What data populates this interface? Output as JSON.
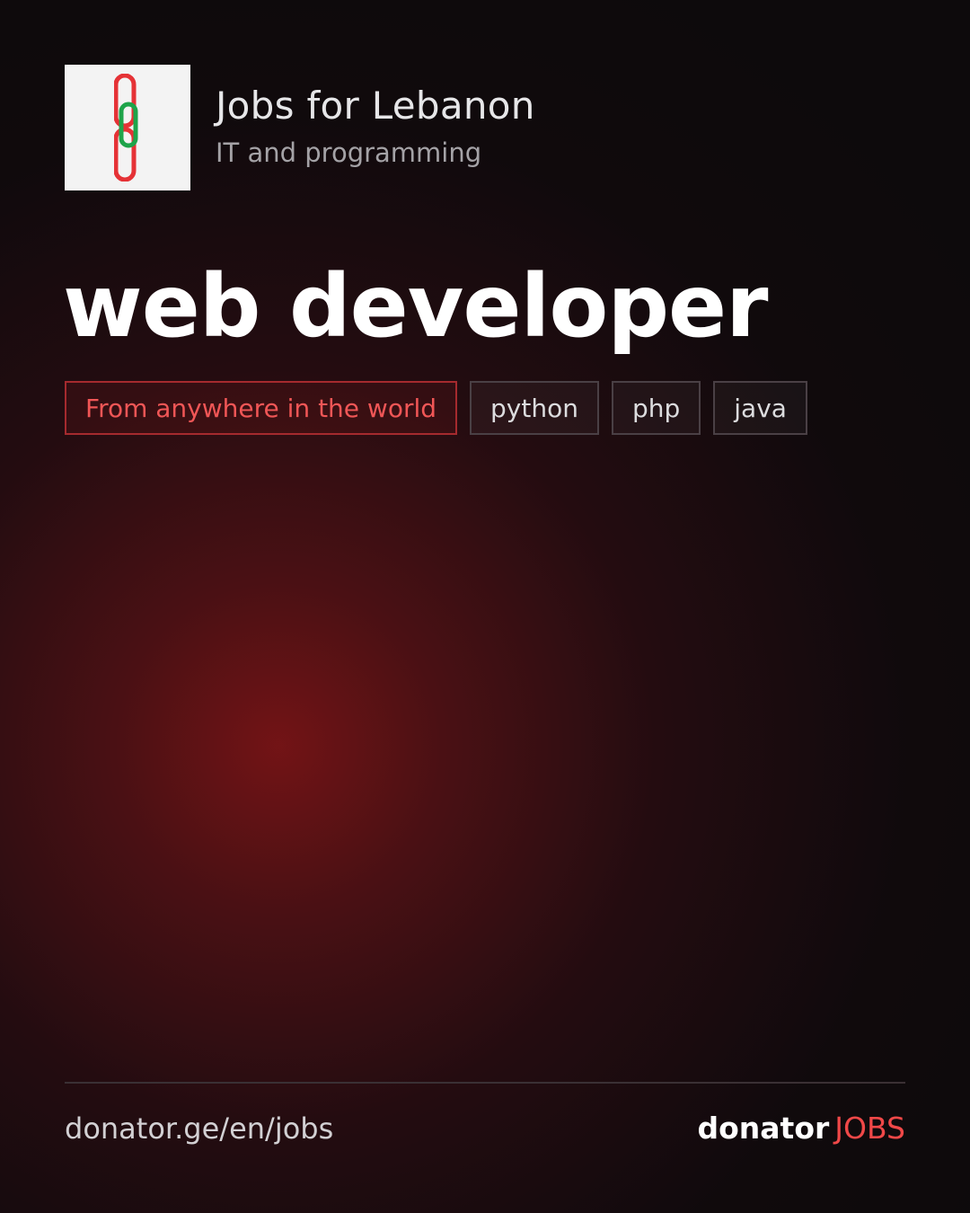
{
  "header": {
    "org_name": "Jobs for Lebanon",
    "category": "IT and programming",
    "logo_icon": "chain-link-icon",
    "logo_colors": {
      "outer": "#e53236",
      "inner": "#1ea44a",
      "background": "#f3f3f3"
    }
  },
  "job": {
    "title": "web developer"
  },
  "tags": {
    "location": "From anywhere in the world",
    "skills": [
      "python",
      "php",
      "java"
    ]
  },
  "footer": {
    "url": "donator.ge/en/jobs",
    "brand_name": "donator",
    "brand_accent": "JOBS"
  },
  "colors": {
    "accent_red": "#f04848",
    "background": "#0d0a0c",
    "glow": "#78141a"
  }
}
